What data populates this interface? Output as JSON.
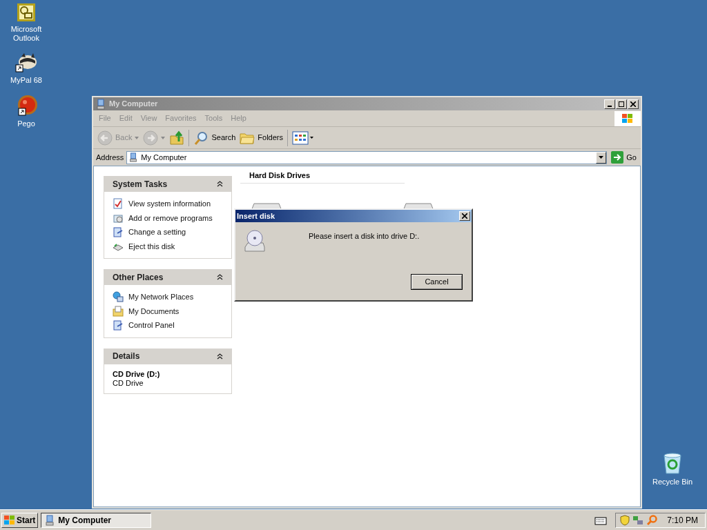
{
  "desktop_icons": [
    {
      "label": "Microsoft Outlook",
      "kind": "outlook"
    },
    {
      "label": "MyPal 68",
      "kind": "mypal"
    },
    {
      "label": "Pego",
      "kind": "pego"
    },
    {
      "label": "Recycle Bin",
      "kind": "recycle"
    }
  ],
  "window": {
    "title": "My Computer",
    "menu": [
      "File",
      "Edit",
      "View",
      "Favorites",
      "Tools",
      "Help"
    ],
    "toolbar": [
      {
        "kind": "back",
        "label": "Back",
        "disabled": true
      },
      {
        "kind": "forward",
        "disabled": true
      },
      {
        "kind": "up",
        "disabled": false
      },
      {
        "kind": "search",
        "label": "Search",
        "disabled": false
      },
      {
        "kind": "folders",
        "label": "Folders",
        "disabled": false
      },
      {
        "kind": "views",
        "disabled": false
      }
    ],
    "address": {
      "label": "Address",
      "value": "My Computer",
      "go": "Go"
    },
    "panes": [
      {
        "title": "System Tasks",
        "kind": "links",
        "items": [
          "View system information",
          "Add or remove programs",
          "Change a setting",
          "Eject this disk"
        ]
      },
      {
        "title": "Other Places",
        "kind": "links",
        "items": [
          "My Network Places",
          "My Documents",
          "Control Panel"
        ]
      },
      {
        "title": "Details",
        "kind": "details",
        "name": "CD Drive (D:)",
        "type": "CD Drive"
      }
    ],
    "group": "Hard Disk Drives",
    "drives": [
      {
        "kind": "hard-disk"
      },
      {
        "kind": "hard-disk"
      }
    ]
  },
  "dialog": {
    "title": "Insert disk",
    "message": "Please insert a disk into drive D:.",
    "button": "Cancel"
  },
  "taskbar": {
    "start": "Start",
    "tasks": [
      {
        "label": "My Computer",
        "selected": true
      }
    ],
    "clock": "7:10 PM"
  }
}
